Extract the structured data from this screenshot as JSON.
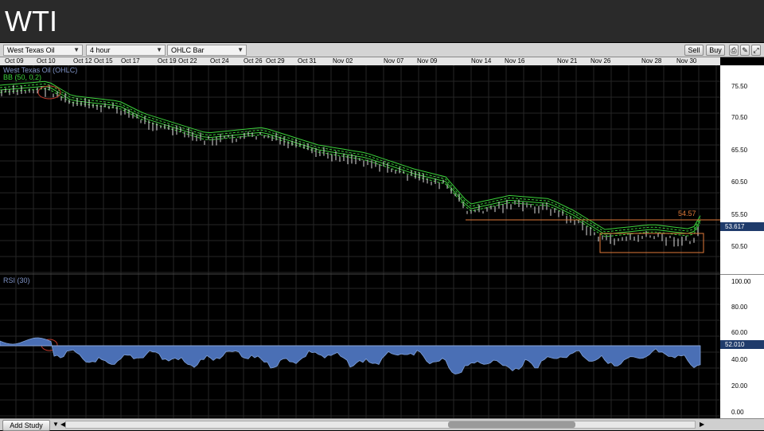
{
  "slide": {
    "title": "WTI"
  },
  "toolbar": {
    "instrument": "West Texas Oil",
    "interval": "4 hour",
    "chart_type": "OHLC Bar",
    "sell_label": "Sell",
    "buy_label": "Buy",
    "icons": [
      "print-icon",
      "settings-icon",
      "expand-icon"
    ]
  },
  "date_axis": [
    "Oct 09",
    "Oct 10",
    "Oct 12",
    "Oct 15",
    "Oct 17",
    "Oct 19",
    "Oct 22",
    "Oct 24",
    "Oct 26",
    "Oct 29",
    "Oct 31",
    "Nov 02",
    "Nov 07",
    "Nov 09",
    "Nov 14",
    "Nov 16",
    "Nov 21",
    "Nov 26",
    "Nov 28",
    "Nov 30"
  ],
  "price_panel": {
    "instrument_label": "West Texas Oil (OHLC)",
    "indicator_label": "BB (50, 0.2)",
    "axis_ticks": [
      "75.50",
      "70.50",
      "65.50",
      "60.50",
      "55.50",
      "50.50"
    ],
    "current_price": "53.617",
    "resistance_label": "54.57"
  },
  "rsi_panel": {
    "label": "RSI (30)",
    "axis_ticks": [
      "100.00",
      "80.00",
      "60.00",
      "40.00",
      "20.00",
      "0.00"
    ],
    "current_value": "52.010"
  },
  "bottom": {
    "add_study": "Add Study"
  },
  "colors": {
    "background": "#000000",
    "bollinger": "#3bd13b",
    "bars": "#ffffff",
    "rsi_fill": "#4a6fb5",
    "annotation": "#e07a3a"
  }
}
